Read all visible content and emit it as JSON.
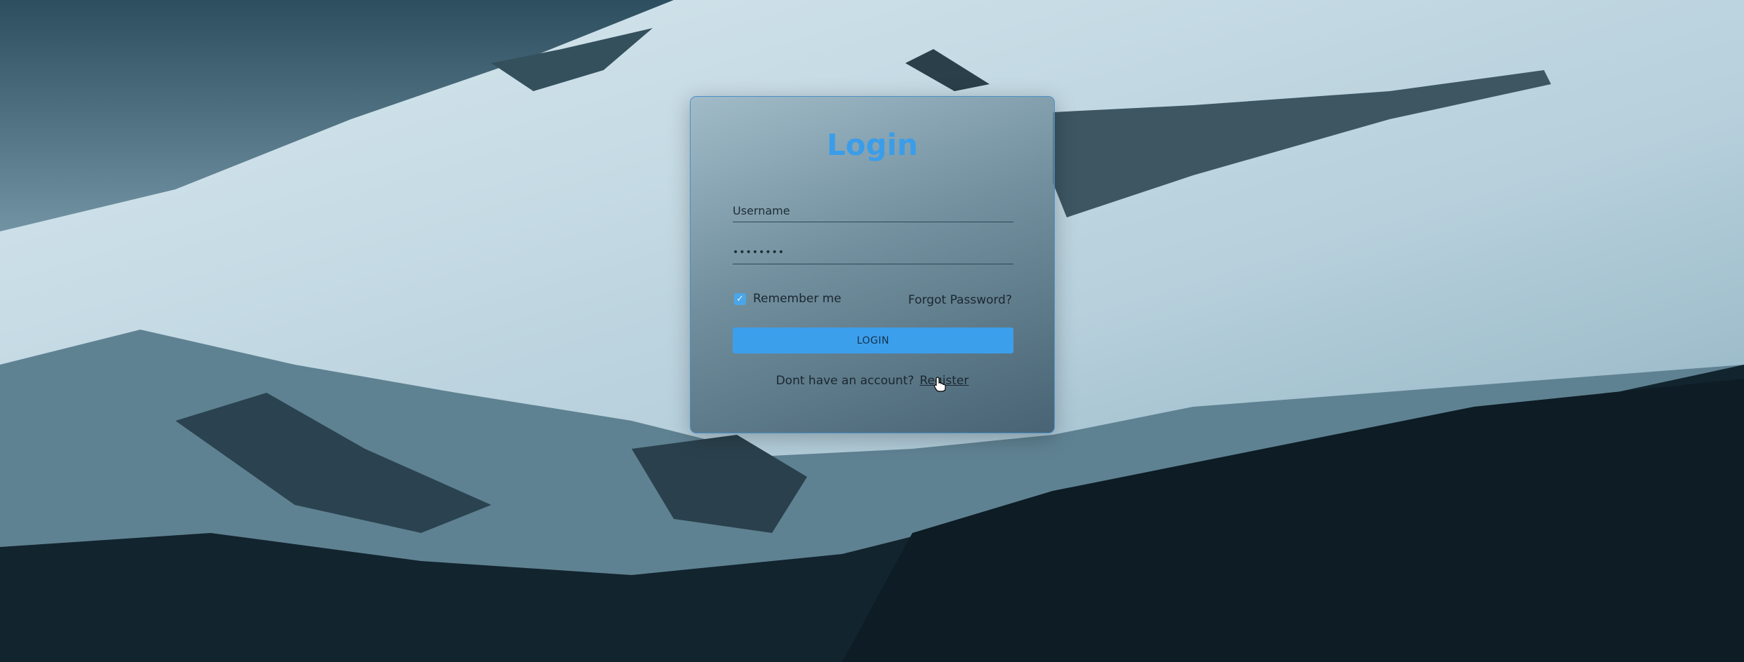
{
  "login": {
    "title": "Login",
    "username_placeholder": "Username",
    "password_value": "••••••••",
    "remember_label": "Remember me",
    "remember_checked": true,
    "forgot_label": "Forgot Password?",
    "login_button": "LOGIN",
    "register_prompt": "Dont have an account?",
    "register_link": "Register"
  },
  "icons": {
    "checkbox": "checkmark-icon",
    "cursor": "hand-pointer-icon"
  },
  "colors": {
    "accent": "#3c9fec",
    "title": "#3b9de9",
    "card_border": "#4a90c9"
  }
}
